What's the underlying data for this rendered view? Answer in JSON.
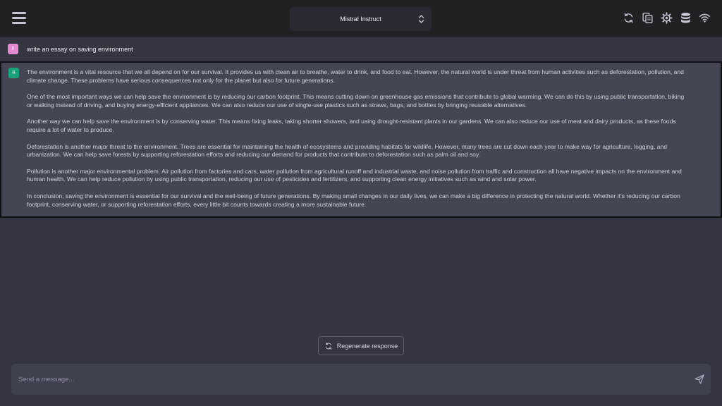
{
  "header": {
    "model_name": "Mistral Instruct",
    "icons": [
      "refresh-icon",
      "copy-icon",
      "settings-gear-icon",
      "database-icon",
      "wifi-icon"
    ]
  },
  "conversation": {
    "user": {
      "avatar_letter": "P",
      "text": "write an essay on saving environment"
    },
    "assistant": {
      "avatar_letter": "R",
      "paragraphs": [
        "The environment is a vital resource that we all depend on for our survival. It provides us with clean air to breathe, water to drink, and food to eat. However, the natural world is under threat from human activities such as deforestation, pollution, and climate change. These problems have serious consequences not only for the planet but also for future generations.",
        "One of the most important ways we can help save the environment is by reducing our carbon footprint. This means cutting down on greenhouse gas emissions that contribute to global warming. We can do this by using public transportation, biking or walking instead of driving, and buying energy-efficient appliances. We can also reduce our use of single-use plastics such as straws, bags, and bottles by bringing reusable alternatives.",
        "Another way we can help save the environment is by conserving water. This means fixing leaks, taking shorter showers, and using drought-resistant plants in our gardens. We can also reduce our use of meat and dairy products, as these foods require a lot of water to produce.",
        "Deforestation is another major threat to the environment. Trees are essential for maintaining the health of ecosystems and providing habitats for wildlife. However, many trees are cut down each year to make way for agriculture, logging, and urbanization. We can help save forests by supporting reforestation efforts and reducing our demand for products that contribute to deforestation such as palm oil and soy.",
        "Pollution is another major environmental problem. Air pollution from factories and cars, water pollution from agricultural runoff and industrial waste, and noise pollution from traffic and construction all have negative impacts on the environment and human health. We can help reduce pollution by using public transportation, reducing our use of pesticides and fertilizers, and supporting clean energy initiatives such as wind and solar power.",
        "In conclusion, saving the environment is essential for our survival and the well-being of future generations. By making small changes in our daily lives, we can make a big difference in protecting the natural world. Whether it's reducing our carbon footprint, conserving water, or supporting reforestation efforts, every little bit counts towards creating a more sustainable future."
      ]
    }
  },
  "regenerate_label": "Regenerate response",
  "composer": {
    "placeholder": "Send a message...",
    "value": ""
  },
  "colors": {
    "topbar": "#202123",
    "background": "#343541",
    "assistant_bg": "#444654",
    "user_avatar": "#e58ad1",
    "assistant_avatar": "#19a37d"
  }
}
